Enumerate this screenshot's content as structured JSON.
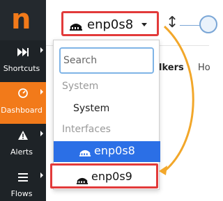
{
  "sidebar": {
    "logo": "n",
    "items": [
      {
        "label": "Shortcuts",
        "icon": "fast-forward-icon"
      },
      {
        "label": "Dashboard",
        "icon": "gauge-icon"
      },
      {
        "label": "Alerts",
        "icon": "warning-icon"
      },
      {
        "label": "Flows",
        "icon": "list-icon"
      }
    ]
  },
  "topbar": {
    "interface_selector": {
      "value": "enp0s8",
      "icon": "network-card-icon"
    },
    "background_tabs": [
      "lkers",
      "Ho"
    ]
  },
  "dropdown": {
    "search_placeholder": "Search",
    "groups": [
      {
        "label": "System",
        "options": [
          "System"
        ]
      },
      {
        "label": "Interfaces",
        "options": [
          "enp0s8",
          "enp0s9"
        ]
      }
    ],
    "selected": "enp0s8",
    "highlighted": "enp0s9"
  },
  "colors": {
    "accent": "#f27a1a",
    "highlight_border": "#e23a3a",
    "selected_bg": "#2b6fe6",
    "arrow": "#f2a72a"
  }
}
